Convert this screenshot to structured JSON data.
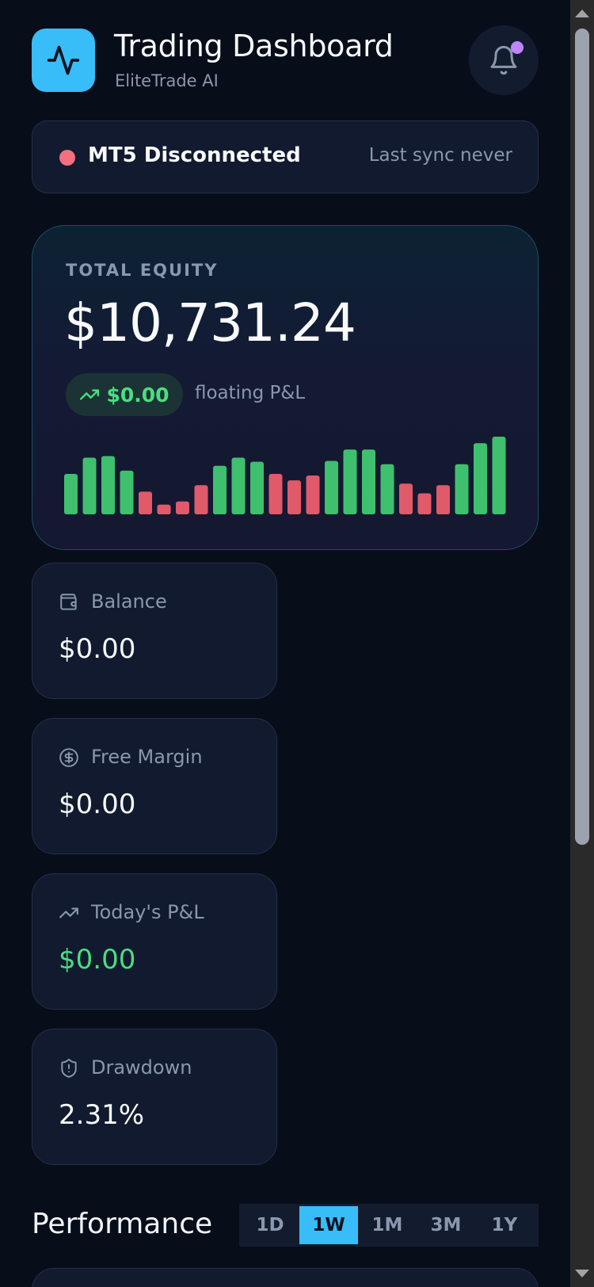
{
  "header": {
    "title": "Trading Dashboard",
    "subtitle": "EliteTrade AI",
    "icon": "activity-icon",
    "notification_icon": "bell-icon"
  },
  "status": {
    "text": "MT5 Disconnected",
    "last_sync": "Last sync never",
    "color": "#f2707f"
  },
  "equity": {
    "label": "TOTAL EQUITY",
    "value": "$10,731.24",
    "floating_pnl": "$0.00",
    "floating_label": "floating P&L"
  },
  "chart_data": {
    "type": "bar",
    "values": [
      50,
      70,
      72,
      54,
      28,
      12,
      16,
      36,
      60,
      70,
      65,
      50,
      42,
      48,
      66,
      80,
      80,
      62,
      38,
      26,
      36,
      62,
      88,
      96
    ],
    "direction": [
      "up",
      "up",
      "up",
      "up",
      "down",
      "down",
      "down",
      "down",
      "up",
      "up",
      "up",
      "down",
      "down",
      "down",
      "up",
      "up",
      "up",
      "up",
      "down",
      "down",
      "down",
      "up",
      "up",
      "up"
    ],
    "colors": {
      "up": "#3ec06e",
      "down": "#e05a6a"
    }
  },
  "stats": [
    {
      "label": "Balance",
      "value": "$0.00",
      "icon": "wallet-icon"
    },
    {
      "label": "Free Margin",
      "value": "$0.00",
      "icon": "dollar-circle-icon"
    },
    {
      "label": "Today's P&L",
      "value": "$0.00",
      "icon": "trending-up-icon"
    },
    {
      "label": "Drawdown",
      "value": "2.31%",
      "icon": "shield-alert-icon"
    }
  ],
  "performance": {
    "title": "Performance",
    "ranges": [
      "1D",
      "1W",
      "1M",
      "3M",
      "1Y"
    ],
    "selected": "1W"
  },
  "colors": {
    "accent": "#38bdf8",
    "positive": "#4ade80",
    "background": "#080d1a",
    "card": "#111a2e"
  }
}
